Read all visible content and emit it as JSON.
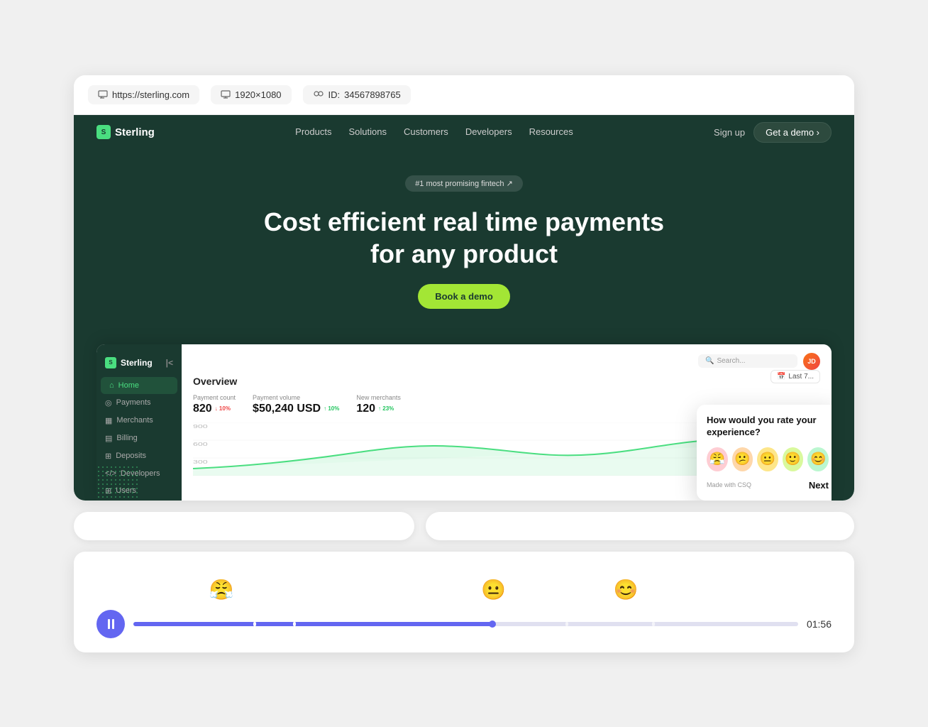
{
  "browser": {
    "url": "https://sterling.com",
    "resolution": "1920×1080",
    "user_id_label": "ID:",
    "user_id": "34567898765"
  },
  "nav": {
    "logo": "Sterling",
    "links": [
      "Products",
      "Solutions",
      "Customers",
      "Developers",
      "Resources"
    ],
    "sign_up": "Sign up",
    "demo_btn": "Get a demo ›"
  },
  "hero": {
    "badge": "#1 most promising fintech ↗",
    "title": "Cost efficient real time payments for any product",
    "cta": "Book a demo"
  },
  "dashboard": {
    "logo": "Sterling",
    "nav_items": [
      {
        "label": "Home",
        "icon": "🏠",
        "active": true
      },
      {
        "label": "Payments",
        "icon": "⊙"
      },
      {
        "label": "Merchants",
        "icon": "🏪"
      },
      {
        "label": "Billing",
        "icon": "📋"
      },
      {
        "label": "Deposits",
        "icon": "📥"
      },
      {
        "label": "Developers",
        "icon": "</>"
      },
      {
        "label": "Users",
        "icon": "👤"
      }
    ],
    "search_placeholder": "Search...",
    "overview_title": "Overview",
    "date_filter": "Last 7...",
    "stats": [
      {
        "label": "Payment count",
        "value": "820",
        "change": "↓ 10%",
        "down": true
      },
      {
        "label": "Payment volume",
        "value": "$50,240 USD",
        "change": "↑ 10%",
        "down": false
      },
      {
        "label": "New merchants",
        "value": "120",
        "change": "↑ 23%",
        "down": false
      }
    ],
    "chart_y_labels": [
      "900",
      "600",
      "300"
    ]
  },
  "survey": {
    "question": "How would you rate your experience?",
    "emojis": [
      "😤",
      "😕",
      "😐",
      "🙂",
      "😊"
    ],
    "emoji_types": [
      "angry",
      "sad",
      "neutral",
      "good",
      "great"
    ],
    "brand": "Made with CSQ",
    "next_btn": "Next"
  },
  "video": {
    "emojis": [
      {
        "icon": "😤",
        "position_pct": 17
      },
      {
        "icon": "😐",
        "position_pct": 54
      },
      {
        "icon": "😊",
        "position_pct": 72
      }
    ],
    "progress_pct": 54,
    "time": "01:56"
  }
}
